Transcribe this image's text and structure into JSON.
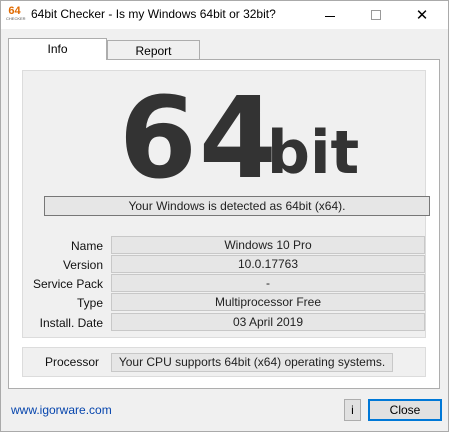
{
  "window": {
    "title": "64bit Checker - Is my Windows 64bit or 32bit?",
    "icon": {
      "main": "64",
      "sub": "CHECKER",
      "semantic": "app-logo-icon"
    },
    "controls": {
      "minimize": "minimize-icon",
      "maximize": "maximize-icon",
      "close_glyph": "✕"
    }
  },
  "tabs": [
    {
      "label": "Info",
      "active": true
    },
    {
      "label": "Report",
      "active": false
    }
  ],
  "info": {
    "big_number": "64",
    "big_unit": "bit",
    "detection_text": "Your Windows is detected as 64bit (x64).",
    "rows": [
      {
        "label": "Name",
        "value": "Windows 10 Pro"
      },
      {
        "label": "Version",
        "value": "10.0.17763"
      },
      {
        "label": "Service Pack",
        "value": "-"
      },
      {
        "label": "Type",
        "value": "Multiprocessor Free"
      },
      {
        "label": "Install. Date",
        "value": "03 April 2019"
      }
    ],
    "processor": {
      "label": "Processor",
      "value": "Your CPU supports 64bit (x64) operating systems."
    }
  },
  "footer": {
    "link_text": "www.igorware.com",
    "info_button": "i",
    "close_button": "Close"
  },
  "colors": {
    "link": "#0645ad",
    "big_text": "#333333",
    "accent_border": "#0078d7",
    "logo": "#e06a00"
  }
}
